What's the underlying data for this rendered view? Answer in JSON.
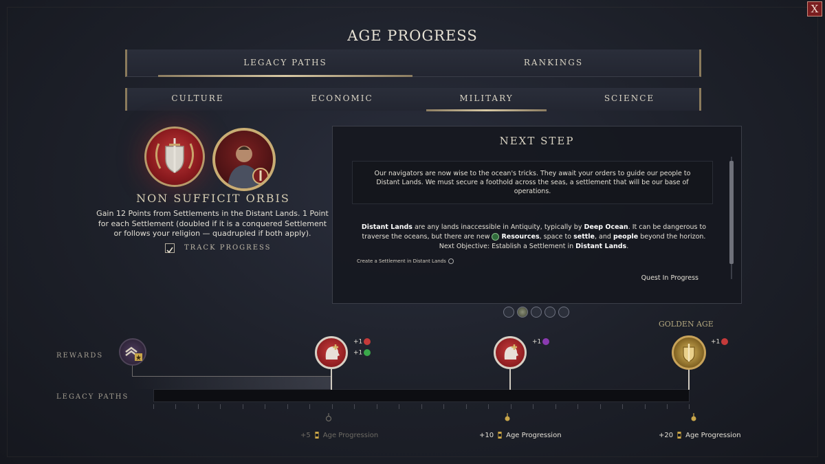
{
  "header": {
    "title": "AGE PROGRESS",
    "close_label": "X"
  },
  "main_tabs": [
    {
      "label": "LEGACY PATHS",
      "active": true
    },
    {
      "label": "RANKINGS",
      "active": false
    }
  ],
  "sub_tabs": [
    {
      "label": "CULTURE",
      "active": false
    },
    {
      "label": "ECONOMIC",
      "active": false
    },
    {
      "label": "MILITARY",
      "active": true
    },
    {
      "label": "SCIENCE",
      "active": false
    }
  ],
  "leader": {
    "name": "NON SUFFICIT ORBIS",
    "description": "Gain 12 Points from Settlements in the Distant Lands. 1 Point for each Settlement (doubled if it is a conquered Settlement or follows your religion — quadrupled if both apply).",
    "track_progress_label": "TRACK PROGRESS",
    "track_progress_checked": true,
    "shield_icon": "shield-sword-icon",
    "portrait_icon": "leader-portrait-icon"
  },
  "next_step": {
    "title": "NEXT STEP",
    "intro": "Our navigators are now wise to the ocean's tricks. They await your orders to guide our people to Distant Lands. We must secure a foothold across the seas, a settlement that will be our base of operations.",
    "body": {
      "t1": "Distant Lands",
      "t2": " are any lands inaccessible in Antiquity, typically by ",
      "t3": "Deep Ocean",
      "t4": ". It can be dangerous to traverse the oceans, but there are new ",
      "t5": "Resources",
      "t6": ", space to ",
      "t7": "settle",
      "t8": ", and ",
      "t9": "people",
      "t10": " beyond the horizon.",
      "t11": "Next Objective: Establish a Settlement in ",
      "t12": "Distant Lands",
      "t13": "."
    },
    "objective": "Create a Settlement in Distant Lands",
    "status": "Quest In Progress",
    "pager_count": 5,
    "pager_active": 2
  },
  "timeline": {
    "rewards_label": "REWARDS",
    "legacy_label": "LEGACY PATHS",
    "golden_age_label": "GOLDEN AGE",
    "rewards": [
      {
        "icon": "rank-chevron-star-icon"
      },
      {
        "icon": "head-plus-icon",
        "bonuses": [
          {
            "text": "+1",
            "icon": "red-token-icon",
            "color": "#c43a3a"
          },
          {
            "text": "+1",
            "icon": "green-token-icon",
            "color": "#3aa84a"
          }
        ]
      },
      {
        "icon": "head-plus-icon",
        "bonuses": [
          {
            "text": "+1",
            "icon": "purple-token-icon",
            "color": "#8a3ab0"
          }
        ]
      },
      {
        "icon": "golden-shield-icon",
        "bonuses": [
          {
            "text": "+1",
            "icon": "red-token-icon",
            "color": "#c43a3a"
          }
        ]
      }
    ],
    "milestones": [
      {
        "amount": "+5",
        "label": "Age Progression",
        "reached": false
      },
      {
        "amount": "+10",
        "label": "Age Progression",
        "reached": true
      },
      {
        "amount": "+20",
        "label": "Age Progression",
        "reached": true
      }
    ],
    "progress_fraction": 0.0
  },
  "colors": {
    "accent_gold": "#c9ad74",
    "reward_red": "#8e1d20",
    "panel_bg": "#16181f"
  }
}
